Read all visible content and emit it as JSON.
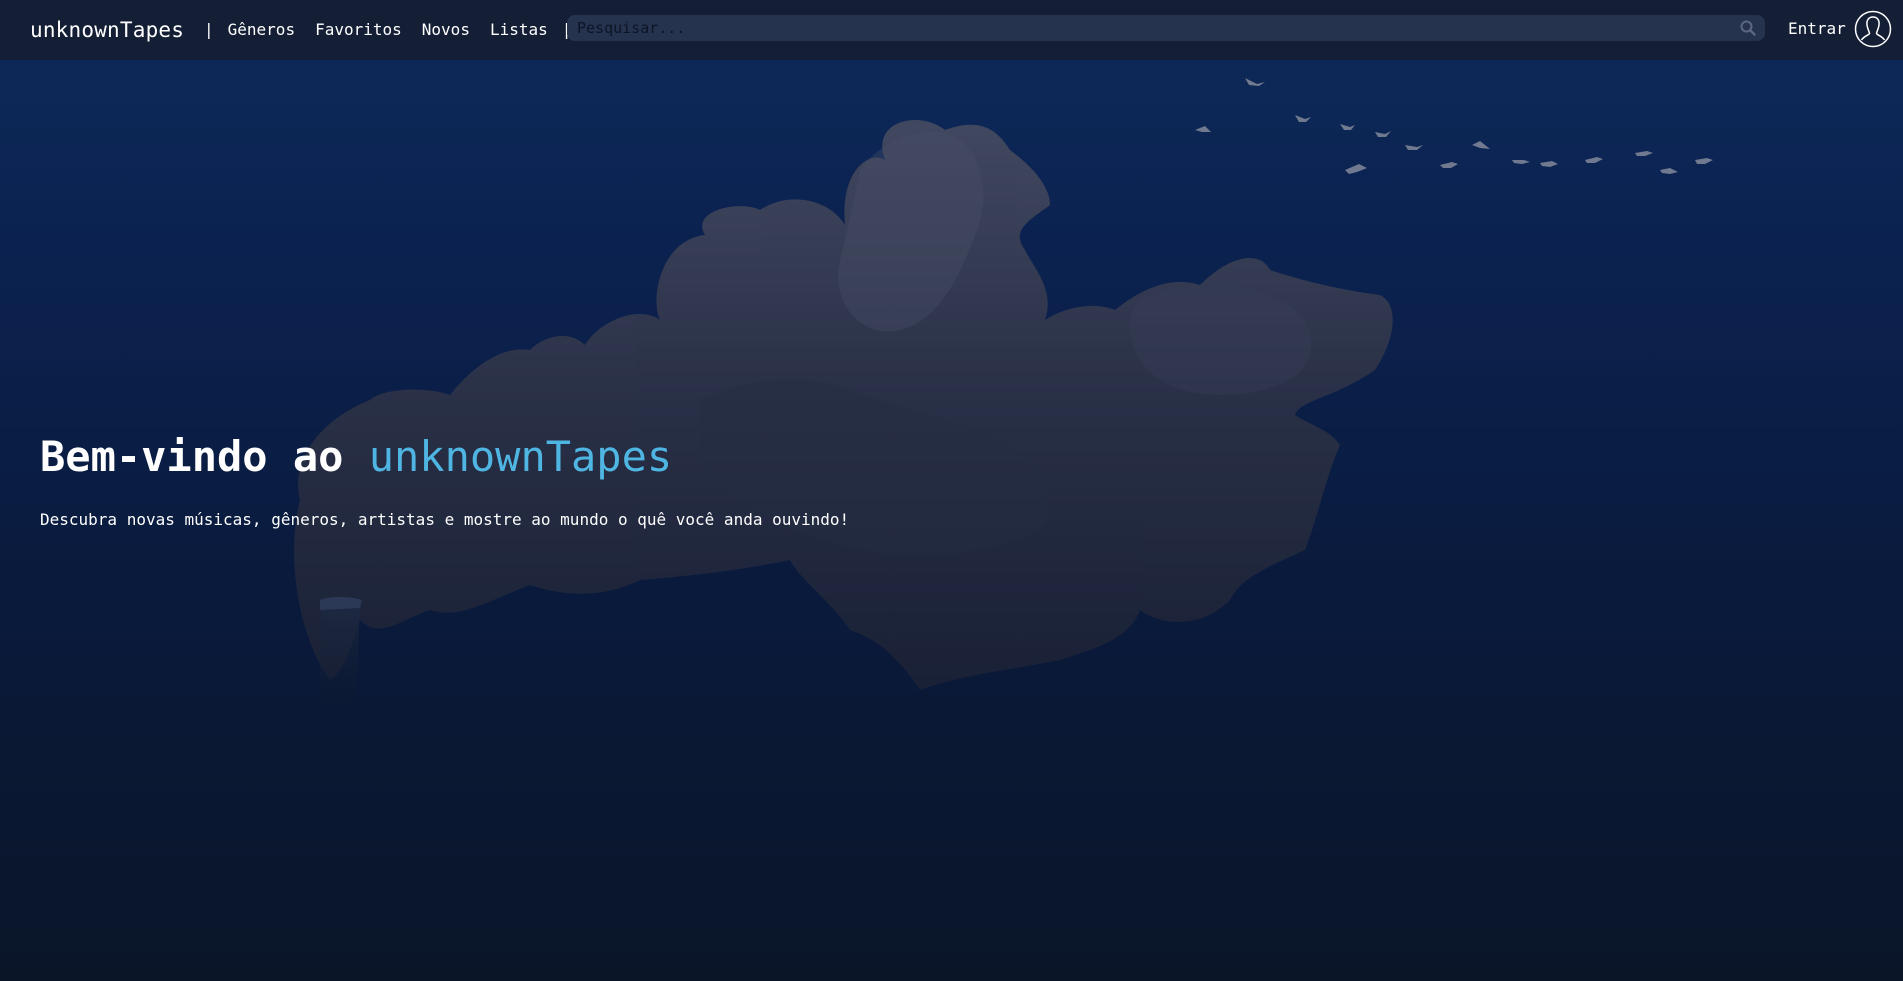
{
  "header": {
    "brand": "unknownTapes",
    "nav_open": "|",
    "nav_close": "|",
    "nav": [
      {
        "label": "Gêneros"
      },
      {
        "label": "Favoritos"
      },
      {
        "label": "Novos"
      },
      {
        "label": "Listas"
      }
    ],
    "search": {
      "placeholder": "Pesquisar...",
      "value": "",
      "icon": "search-icon"
    },
    "login_label": "Entrar",
    "avatar_icon": "user-avatar-icon"
  },
  "hero": {
    "title_prefix": "Bem-vindo ao ",
    "title_brand": "unknownTapes",
    "subtitle": "Descubra novas músicas, gêneros, artistas e mostre ao mundo o quê você anda ouvindo!"
  },
  "colors": {
    "accent": "#4fb6e3",
    "navbar": "#141f36",
    "search_bg": "#25334f",
    "background_top": "#0e2a5a",
    "background_bottom": "#0a1528",
    "smoke": "#3a3f55"
  }
}
